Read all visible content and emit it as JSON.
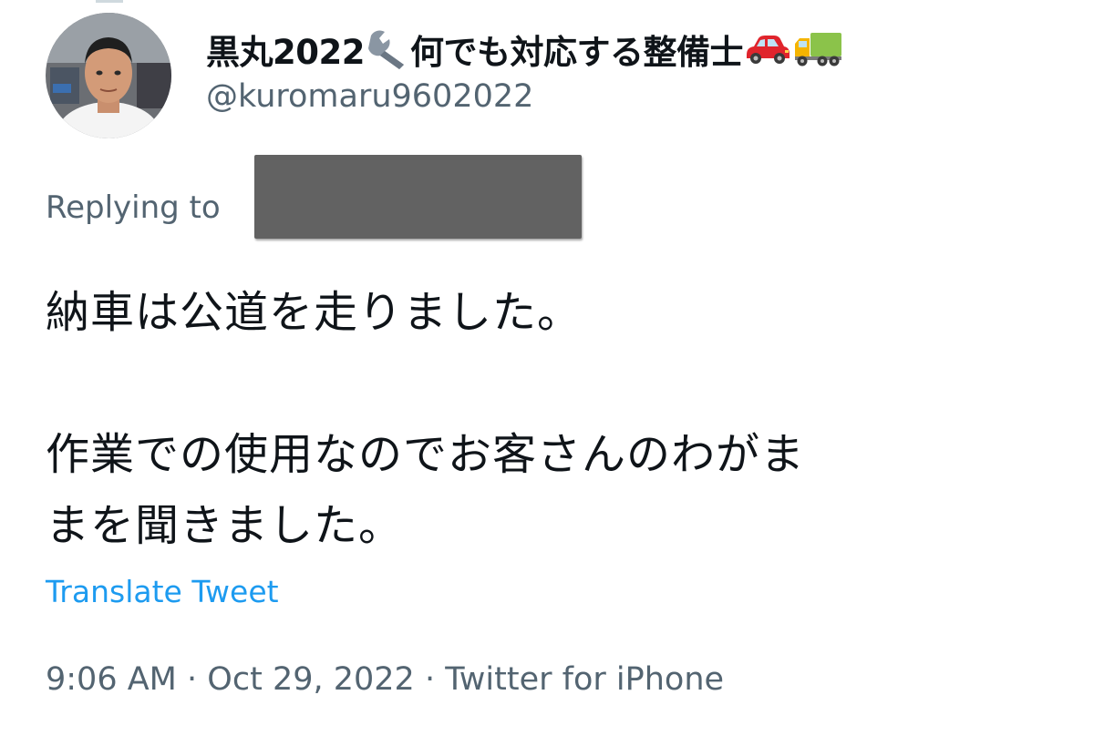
{
  "author": {
    "display_name_part1": "黒丸2022",
    "display_name_part2": "何でも対応する整備士",
    "handle": "@kuromaru9602022",
    "name_icons": [
      "wrench-icon",
      "car-icon",
      "truck-icon"
    ]
  },
  "reply": {
    "label": "Replying to"
  },
  "tweet": {
    "text": "納車は公道を走りました。\n\n作業での使用なのでお客さんのわがま\nまを聞きました。",
    "translate_label": "Translate Tweet",
    "time": "9:06 AM",
    "date": "Oct 29, 2022",
    "source": "Twitter for iPhone",
    "separator": "·"
  },
  "colors": {
    "text": "#0f1419",
    "secondary": "#536471",
    "link": "#1d9bf0",
    "redaction": "#626262"
  }
}
